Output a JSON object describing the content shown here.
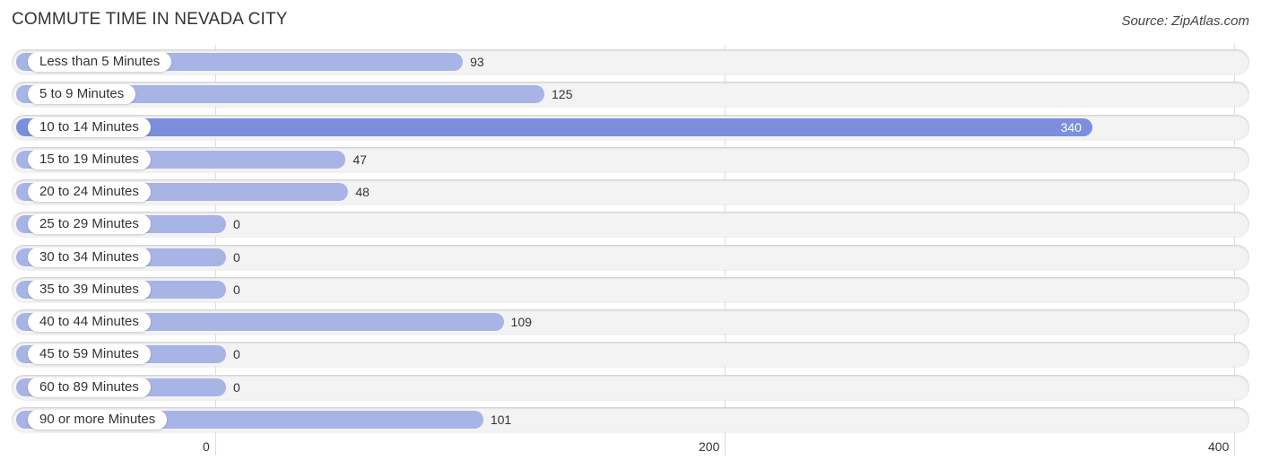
{
  "header": {
    "title": "COMMUTE TIME IN NEVADA CITY",
    "source": "Source: ZipAtlas.com"
  },
  "colors": {
    "bar_normal": "#a8b3e6",
    "bar_highlight": "#7b8fdd",
    "track": "#f3f3f3"
  },
  "chart_data": {
    "type": "bar",
    "orientation": "horizontal",
    "title": "COMMUTE TIME IN NEVADA CITY",
    "xlabel": "",
    "ylabel": "",
    "categories": [
      "Less than 5 Minutes",
      "5 to 9 Minutes",
      "10 to 14 Minutes",
      "15 to 19 Minutes",
      "20 to 24 Minutes",
      "25 to 29 Minutes",
      "30 to 34 Minutes",
      "35 to 39 Minutes",
      "40 to 44 Minutes",
      "45 to 59 Minutes",
      "60 to 89 Minutes",
      "90 or more Minutes"
    ],
    "values": [
      93,
      125,
      340,
      47,
      48,
      0,
      0,
      0,
      109,
      0,
      0,
      101
    ],
    "xlim": [
      0,
      400
    ],
    "xticks": [
      0,
      200,
      400
    ],
    "xtick_labels": [
      "0",
      "200",
      "400"
    ],
    "highlight_index": 2,
    "grid": true
  }
}
